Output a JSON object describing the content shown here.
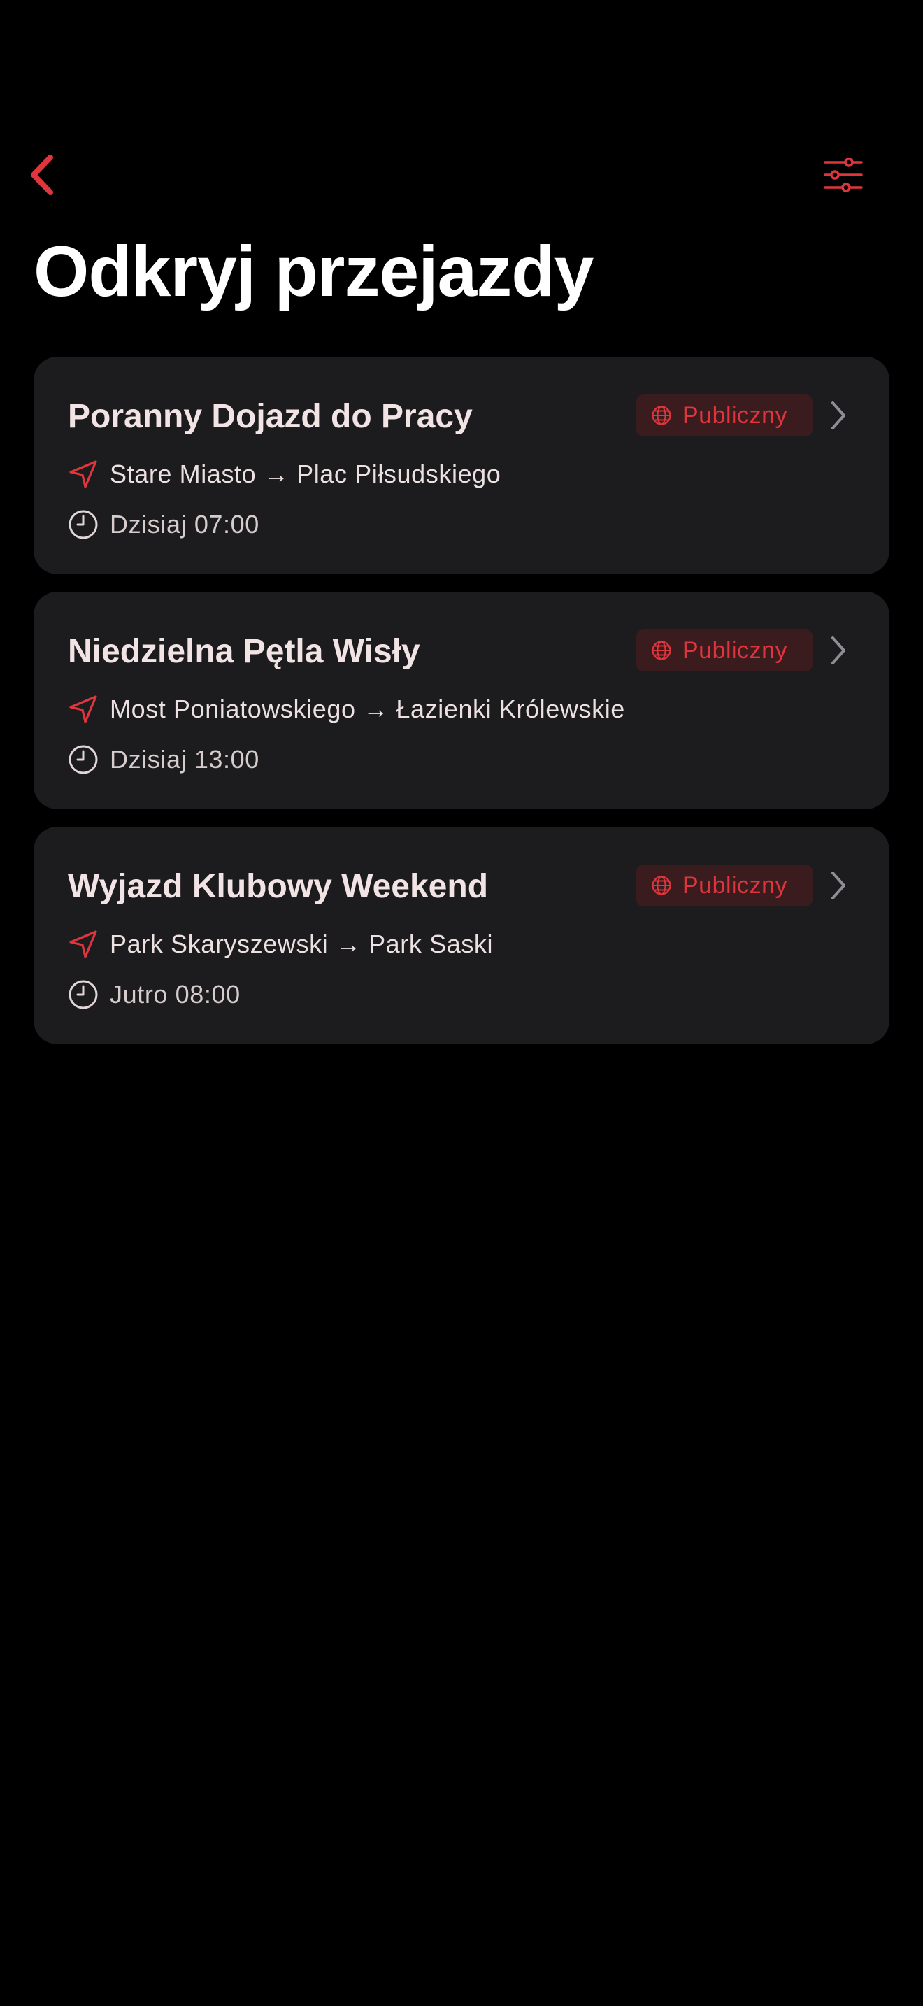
{
  "header": {
    "title": "Odkryj przejazdy",
    "back_icon": "chevron-left-icon",
    "filter_icon": "sliders-icon"
  },
  "colors": {
    "background": "#000000",
    "card": "#1c1c1e",
    "accent": "#e0353d",
    "badge_background": "#3a1c1f",
    "text_primary": "#f2e4e4",
    "chevron": "#8e8e93"
  },
  "rides": [
    {
      "title": "Poranny Dojazd do Pracy",
      "visibility": "Publiczny",
      "route": "Stare Miasto → Plac Piłsudskiego",
      "time": "Dzisiaj 07:00"
    },
    {
      "title": "Niedzielna Pętla Wisły",
      "visibility": "Publiczny",
      "route": "Most Poniatowskiego → Łazienki Królewskie",
      "time": "Dzisiaj 13:00"
    },
    {
      "title": "Wyjazd Klubowy Weekend",
      "visibility": "Publiczny",
      "route": "Park Skaryszewski → Park Saski",
      "time": "Jutro 08:00"
    }
  ]
}
